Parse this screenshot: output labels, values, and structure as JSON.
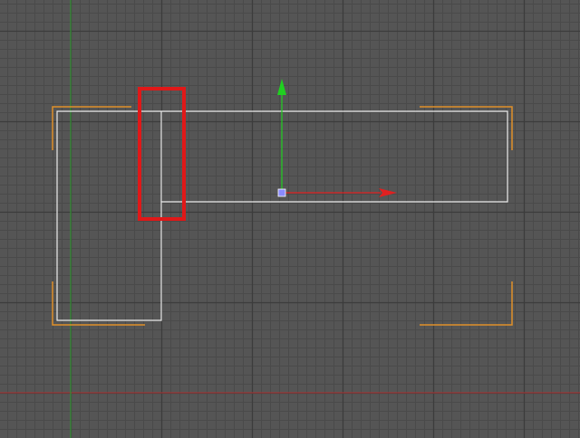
{
  "viewport": {
    "name": "top-viewport",
    "background_color": "#555555",
    "grid_minor_color": "#4a4a4a",
    "grid_major_color": "#3c3c3c",
    "world_axis_x_color": "#b03030",
    "world_axis_y_color": "#2e9e2e"
  },
  "shape": {
    "name": "l-shaped-spline",
    "stroke_color": "#ececec"
  },
  "selection_bracket": {
    "color": "#e0902a"
  },
  "gizmo": {
    "x_axis_color": "#e02020",
    "y_axis_color": "#20d020",
    "pivot_color": "#8a8aff"
  },
  "highlight": {
    "color": "#e01818"
  }
}
